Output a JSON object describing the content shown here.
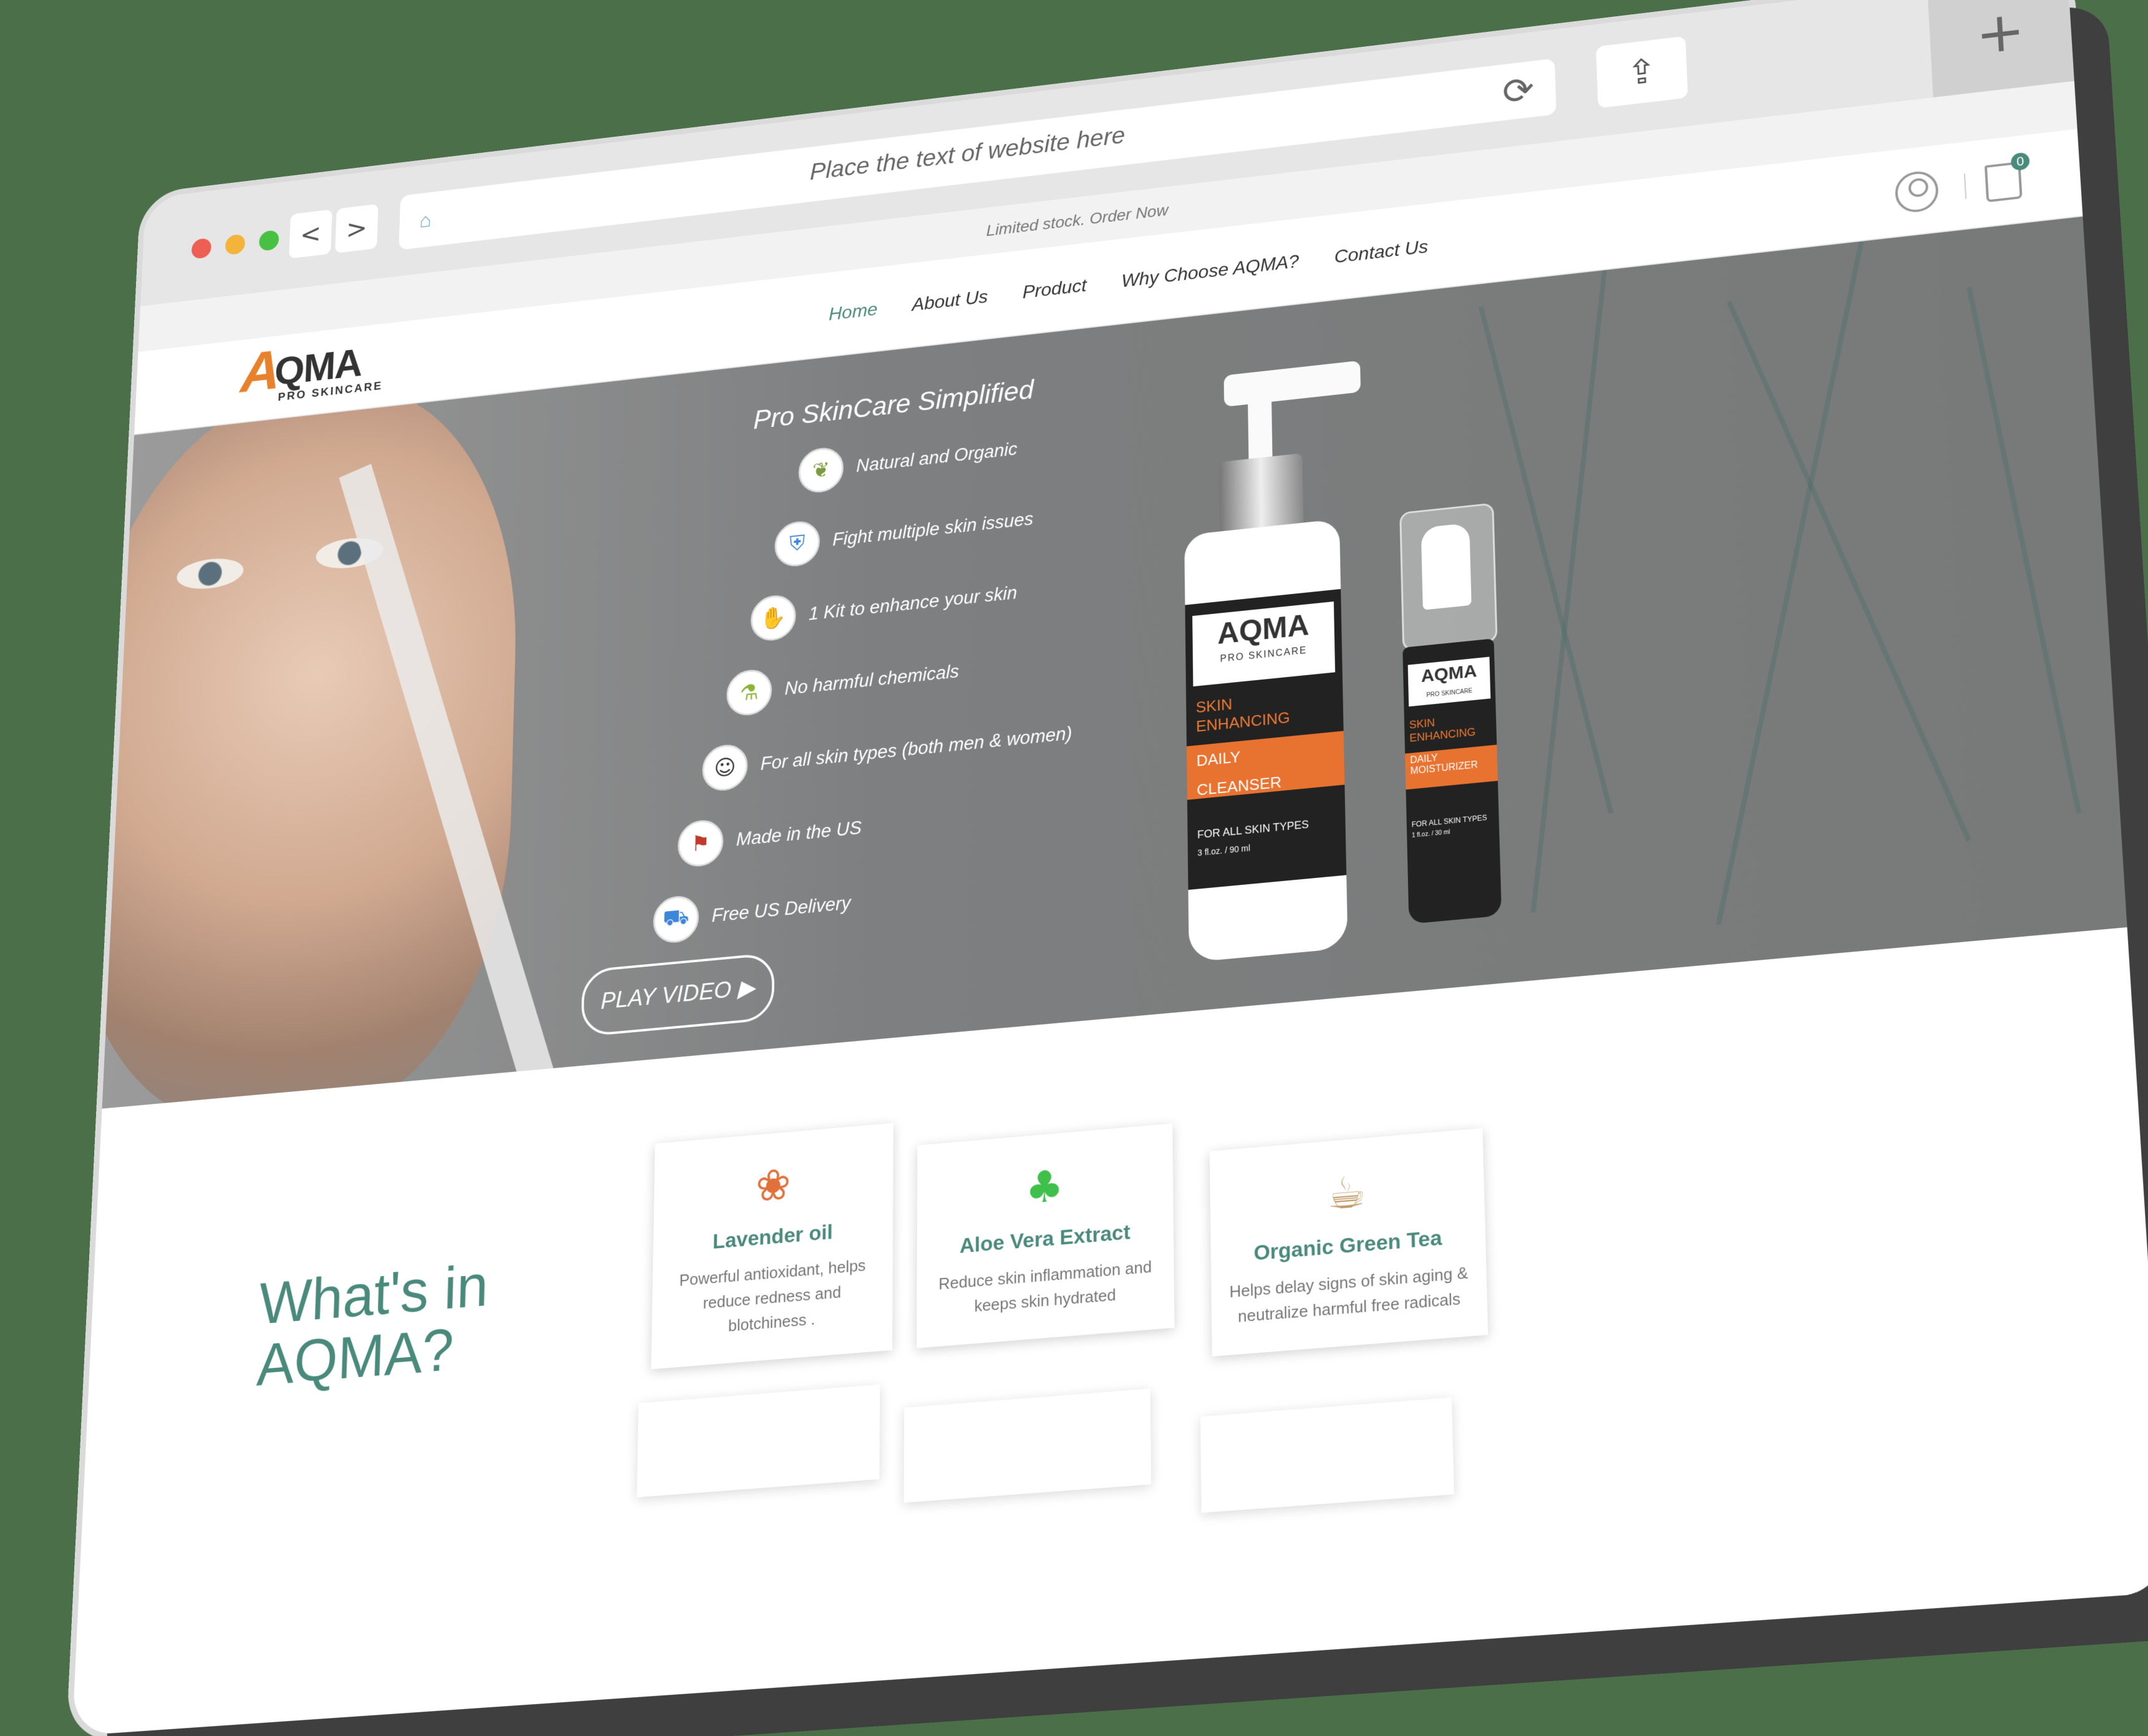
{
  "browser": {
    "url_text": "Place the text of website here",
    "dots": [
      "#ec5f52",
      "#f4b33a",
      "#48c142"
    ],
    "back_icon": "<",
    "forward_icon": ">",
    "reload_icon": "⟳",
    "share_icon": "⇪",
    "newtab_icon": "+",
    "lock_icon": "⌂"
  },
  "announcement": "Limited stock. Order Now",
  "header": {
    "logo_mark": "A",
    "logo_word": "QMA",
    "logo_sub": "PRO SKINCARE",
    "nav": [
      "Home",
      "About Us",
      "Product",
      "Why Choose AQMA?",
      "Contact Us"
    ],
    "cart_count": "0"
  },
  "hero": {
    "title": "Pro SkinCare Simplified",
    "features": [
      {
        "label": "Natural and Organic",
        "icon": "leaf-icon",
        "glyph": "❦"
      },
      {
        "label": "Fight multiple skin issues",
        "icon": "shield-icon",
        "glyph": "⛨"
      },
      {
        "label": "1 Kit to enhance your skin",
        "icon": "hand-icon",
        "glyph": "✋"
      },
      {
        "label": "No harmful chemicals",
        "icon": "flask-icon",
        "glyph": "⚗"
      },
      {
        "label": "For all skin types (both men & women)",
        "icon": "face-icon",
        "glyph": "☺"
      },
      {
        "label": "Made in the US",
        "icon": "us-flag-icon",
        "glyph": "⚑"
      },
      {
        "label": "Free US Delivery",
        "icon": "delivery-icon",
        "glyph": "⛟"
      }
    ],
    "play_video": "PLAY VIDEO",
    "play_icon": "▶"
  },
  "products": {
    "cleanser": {
      "brand": "AQMA",
      "brand_sub": "PRO SKINCARE",
      "line1": "SKIN",
      "line2": "ENHANCING",
      "band1": "DAILY",
      "band2": "CLEANSER",
      "skin_types": "FOR ALL SKIN TYPES",
      "volume": "3 fl.oz. / 90 ml"
    },
    "moisturizer": {
      "brand": "AQMA",
      "brand_sub": "PRO SKINCARE",
      "line1": "SKIN",
      "line2": "ENHANCING",
      "band1": "DAILY",
      "band2": "MOISTURIZER",
      "skin_types": "FOR ALL SKIN TYPES",
      "volume": "1 fl.oz. / 30 ml"
    }
  },
  "ingredients": {
    "title_line1": "What's in",
    "title_line2": "AQMA?",
    "cards": [
      {
        "name": "Lavender oil",
        "desc": "Powerful antioxidant, helps reduce redness and blotchiness .",
        "icon": "lavender-icon",
        "glyph": "❀",
        "color": "#e2703a"
      },
      {
        "name": "Aloe Vera Extract",
        "desc": "Reduce skin inflammation and keeps skin hydrated",
        "icon": "aloe-icon",
        "glyph": "♣",
        "color": "#3ec04a"
      },
      {
        "name": "Organic Green Tea",
        "desc": "Helps delay signs of skin aging & neutralize harmful free radicals",
        "icon": "tea-icon",
        "glyph": "☕",
        "color": "#c29a68"
      }
    ]
  },
  "colors": {
    "accent": "#4a8a7c",
    "orange": "#e8722f",
    "hero_bg": "#7e7f80"
  }
}
